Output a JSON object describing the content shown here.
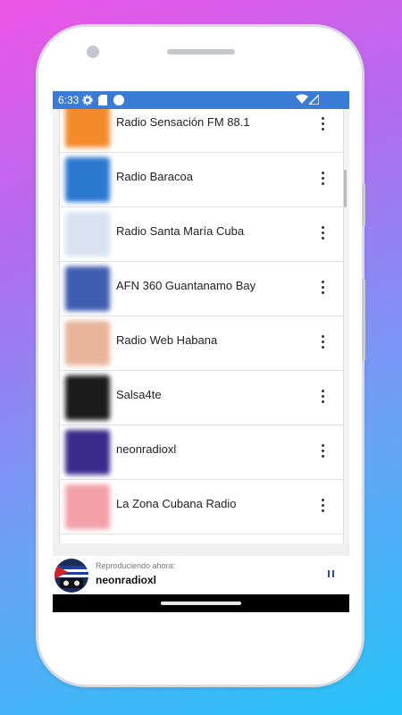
{
  "status_bar": {
    "time": "6:33"
  },
  "stations": [
    {
      "name": "Radio Sensación FM 88.1",
      "thumb_color": "#f28a2c"
    },
    {
      "name": "Radio Baracoa",
      "thumb_color": "#2a78cf"
    },
    {
      "name": "Radio Santa María Cuba",
      "thumb_color": "#d8e2f0"
    },
    {
      "name": "AFN 360 Guantanamo Bay",
      "thumb_color": "#3f5db0"
    },
    {
      "name": "Radio Web Habana",
      "thumb_color": "#e8b49a"
    },
    {
      "name": "Salsa4te",
      "thumb_color": "#1a1a1a"
    },
    {
      "name": "neonradioxl",
      "thumb_color": "#3a2a8a"
    },
    {
      "name": "La Zona Cubana Radio",
      "thumb_color": "#f3a0a8"
    }
  ],
  "player": {
    "now_playing_label": "Reproduciendo ahora:",
    "station": "neonradioxl"
  }
}
